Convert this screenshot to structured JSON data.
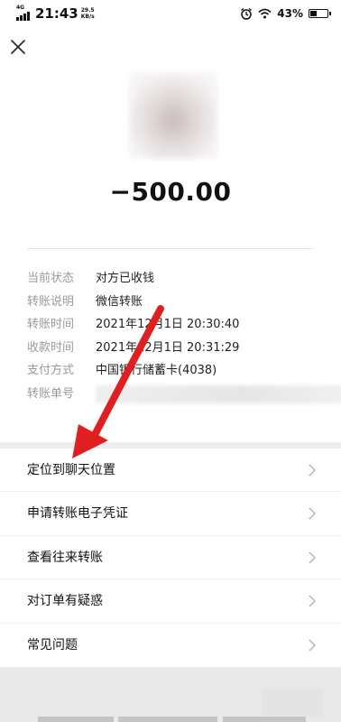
{
  "status_bar": {
    "network": "4G",
    "time": "21:43",
    "speed_value": "29.5",
    "speed_unit": "KB/s",
    "battery": "43%",
    "battery_level": 0.43,
    "icons": [
      "signal-icon",
      "alarm-icon",
      "wifi-icon",
      "battery-icon"
    ]
  },
  "header": {
    "close_icon": "close-icon"
  },
  "transfer": {
    "amount": "−500.00"
  },
  "details": [
    {
      "label": "当前状态",
      "value": "对方已收钱"
    },
    {
      "label": "转账说明",
      "value": "微信转账"
    },
    {
      "label": "转账时间",
      "value": "2021年12月1日 20:30:40"
    },
    {
      "label": "收款时间",
      "value": "2021年12月1日 20:31:29"
    },
    {
      "label": "支付方式",
      "value": "中国银行储蓄卡(4038)"
    },
    {
      "label": "转账单号",
      "value": ""
    }
  ],
  "menu": [
    {
      "label": "定位到聊天位置"
    },
    {
      "label": "申请转账电子凭证"
    },
    {
      "label": "查看往来转账"
    },
    {
      "label": "对订单有疑惑"
    },
    {
      "label": "常见问题"
    }
  ],
  "colors": {
    "annotation_arrow": "#e02020",
    "page_background": "#ededed",
    "label_gray": "#999999"
  }
}
